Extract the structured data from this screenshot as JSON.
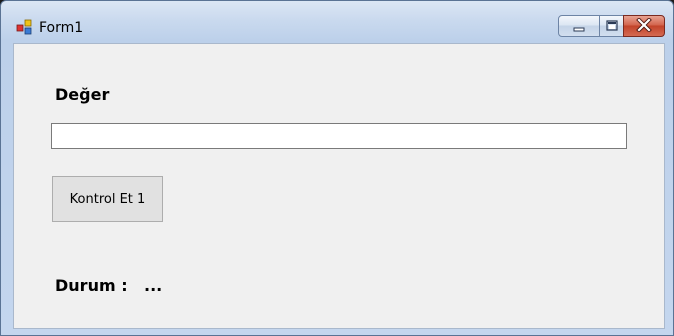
{
  "window": {
    "title": "Form1",
    "icon": "winforms-app-icon",
    "minimize_icon": "minimize-icon",
    "maximize_icon": "maximize-icon",
    "close_icon": "close-icon"
  },
  "form": {
    "value_label": "Değer",
    "value_input": "",
    "check_button_label": "Kontrol Et 1",
    "status_label": "Durum :",
    "status_value": "..."
  }
}
